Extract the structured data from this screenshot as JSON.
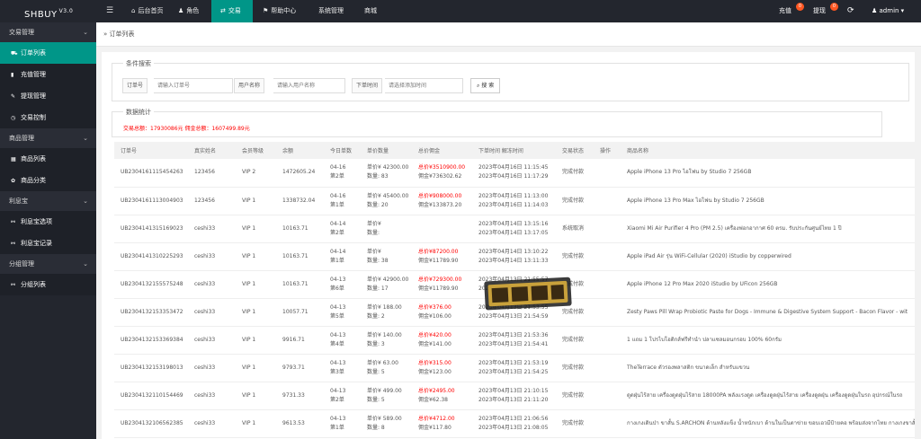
{
  "header": {
    "logo": "SHBUY",
    "version": "V3.0",
    "nav": [
      {
        "label": "后台首页",
        "icon": "home-icon",
        "glyph": "⌂"
      },
      {
        "label": "角色",
        "icon": "user-icon",
        "glyph": "♟"
      },
      {
        "label": "交易",
        "icon": "transaction-icon",
        "glyph": "⇄"
      },
      {
        "label": "帮助中心",
        "icon": "flag-icon",
        "glyph": "⚑"
      },
      {
        "label": "系统管理",
        "icon": "",
        "glyph": ""
      },
      {
        "label": "商城",
        "icon": "",
        "glyph": ""
      }
    ],
    "recharge": "充值",
    "recharge_badge": "0",
    "withdraw": "提现",
    "withdraw_badge": "0",
    "refresh_glyph": "⟳",
    "user": "admin"
  },
  "sidebar": {
    "groups": [
      {
        "label": "交易管理",
        "items": [
          {
            "label": "订单列表",
            "glyph": "⛟",
            "icon": "cart-icon"
          },
          {
            "label": "充值管理",
            "glyph": "▮",
            "icon": "wallet-icon"
          },
          {
            "label": "提现管理",
            "glyph": "✎",
            "icon": "edit-icon"
          },
          {
            "label": "交易控制",
            "glyph": "◷",
            "icon": "clock-icon"
          }
        ]
      },
      {
        "label": "商品管理",
        "items": [
          {
            "label": "商品列表",
            "glyph": "▦",
            "icon": "list-icon"
          },
          {
            "label": "商品分类",
            "glyph": "✿",
            "icon": "category-icon"
          }
        ]
      },
      {
        "label": "利息宝",
        "items": [
          {
            "label": "利息宝选项",
            "glyph": "⚯",
            "icon": "link-icon"
          },
          {
            "label": "利息宝记录",
            "glyph": "⚯",
            "icon": "link-icon"
          }
        ]
      },
      {
        "label": "分组管理",
        "items": [
          {
            "label": "分组列表",
            "glyph": "⚯",
            "icon": "link-icon"
          }
        ]
      }
    ]
  },
  "breadcrumb": "订单列表",
  "search": {
    "legend": "条件搜索",
    "order_label": "订单号",
    "order_placeholder": "请输入订单号",
    "user_label": "用户名称",
    "user_placeholder": "请输入用户名称",
    "time_label": "下单时间",
    "time_placeholder": "请选择添加时间",
    "button": "搜 索"
  },
  "stats": {
    "legend": "数据统计",
    "text": "交易总额：17930086元   佣金总额：1607499.89元"
  },
  "table": {
    "columns": [
      "订单号",
      "真实姓名",
      "会员等级",
      "余额",
      "今日单数",
      "单价数量",
      "总价佣金",
      "下单时间 解冻时间",
      "交易状态",
      "操作",
      "商品名称"
    ],
    "rows": [
      {
        "order": "UB2304161115454263",
        "name": "123456",
        "level": "VIP 2",
        "balance": "1472605.24",
        "today1": "04-16",
        "today2": "第2单",
        "price1": "单价¥ 42300.00",
        "price2": "数量: 83",
        "total1": "总价¥3510900.00",
        "total2": "佣金¥736302.62",
        "time1": "2023年04月16日 11:15:45",
        "time2": "2023年04月16日 11:17:29",
        "status": "完成付款",
        "product": "Apple iPhone 13 Pro ไอโฟน by Studio 7 256GB"
      },
      {
        "order": "UB2304161113004903",
        "name": "123456",
        "level": "VIP 1",
        "balance": "1338732.04",
        "today1": "04-16",
        "today2": "第1单",
        "price1": "单价¥ 45400.00",
        "price2": "数量: 20",
        "total1": "总价¥908000.00",
        "total2": "佣金¥133873.20",
        "time1": "2023年04月16日 11:13:00",
        "time2": "2023年04月16日 11:14:03",
        "status": "完成付款",
        "product": "Apple iPhone 13 Pro Max ไอโฟน by Studio 7 256GB"
      },
      {
        "order": "UB2304141315169023",
        "name": "ceshi33",
        "level": "VIP 1",
        "balance": "10163.71",
        "today1": "04-14",
        "today2": "第2单",
        "price1": "单价¥",
        "price2": "数量:",
        "total1": "",
        "total2": "",
        "time1": "2023年04月14日 13:15:16",
        "time2": "2023年04月14日 13:17:05",
        "status": "系统取消",
        "product": "Xiaomi Mi Air Purifier 4 Pro (PM 2.5) เครื่องฟอกอากาศ 60 ตรม. รับประกันศูนย์ไทย 1 ปี"
      },
      {
        "order": "UB2304141310225293",
        "name": "ceshi33",
        "level": "VIP 1",
        "balance": "10163.71",
        "today1": "04-14",
        "today2": "第1单",
        "price1": "单价¥",
        "price2": "数量: 38",
        "total1": "总价¥87200.00",
        "total2": "佣金¥11789.90",
        "time1": "2023年04月14日 13:10:22",
        "time2": "2023年04月14日 13:11:33",
        "status": "完成付款",
        "product": "Apple iPad Air รุ่น WiFi-Cellular (2020) iStudio by copperwired"
      },
      {
        "order": "UB2304132155575248",
        "name": "ceshi33",
        "level": "VIP 1",
        "balance": "10163.71",
        "today1": "04-13",
        "today2": "第6单",
        "price1": "单价¥ 42900.00",
        "price2": "数量: 17",
        "total1": "总价¥729300.00",
        "total2": "佣金¥11789.90",
        "time1": "2023年04月13日 21:55:57",
        "time2": "2023年04月13日 22:17:16",
        "status": "完成付款",
        "product": "Apple iPhone 12 Pro Max 2020 iStudio by UFicon 256GB"
      },
      {
        "order": "UB2304132153353472",
        "name": "ceshi33",
        "level": "VIP 1",
        "balance": "10057.71",
        "today1": "04-13",
        "today2": "第5单",
        "price1": "单价¥ 188.00",
        "price2": "数量: 2",
        "total1": "总价¥376.00",
        "total2": "佣金¥106.00",
        "time1": "2023年04月13日 21:53:55",
        "time2": "2023年04月13日 21:54:59",
        "status": "完成付款",
        "product": "Zesty Paws Pill Wrap Probiotic Paste for Dogs - Immune & Digestive System Support - Bacon Flavor - wit"
      },
      {
        "order": "UB2304132153369384",
        "name": "ceshi33",
        "level": "VIP 1",
        "balance": "9916.71",
        "today1": "04-13",
        "today2": "第4单",
        "price1": "单价¥ 140.00",
        "price2": "数量: 3",
        "total1": "总价¥420.00",
        "total2": "佣金¥141.00",
        "time1": "2023年04月13日 21:53:36",
        "time2": "2023年04月13日 21:54:41",
        "status": "完成付款",
        "product": "1 แถม 1 โปรไบโอติกส์ฟรีทำนำ ปลาแซลมอนกรอบ 100% 60กรัม"
      },
      {
        "order": "UB2304132153198013",
        "name": "ceshi33",
        "level": "VIP 1",
        "balance": "9793.71",
        "today1": "04-13",
        "today2": "第3单",
        "price1": "单价¥ 63.00",
        "price2": "数量: 5",
        "total1": "总价¥315.00",
        "total2": "佣金¥123.00",
        "time1": "2023年04月13日 21:53:19",
        "time2": "2023年04月13日 21:54:25",
        "status": "完成付款",
        "product": "TheTerrace ตัวรองพลาสติก ขนาดเล็ก สำหรับแขวน"
      },
      {
        "order": "UB2304132110154469",
        "name": "ceshi33",
        "level": "VIP 1",
        "balance": "9731.33",
        "today1": "04-13",
        "today2": "第2单",
        "price1": "单价¥ 499.00",
        "price2": "数量: 5",
        "total1": "总价¥2495.00",
        "total2": "佣金¥62.38",
        "time1": "2023年04月13日 21:10:15",
        "time2": "2023年04月13日 21:11:20",
        "status": "完成付款",
        "product": "ดูดฝุ่นไร้สาย เครื่องดูดฝุ่นไร้สาย 18000PA พลังแรงดูด เครื่องดูดฝุ่นไร้สาย เครื่องดูดฝุ่น เครื่องดูดฝุ่นในรถ อุปกรณ์ในรถ"
      },
      {
        "order": "UB2304132106562385",
        "name": "ceshi33",
        "level": "VIP 1",
        "balance": "9613.53",
        "today1": "04-13",
        "today2": "第1单",
        "price1": "单价¥ 589.00",
        "price2": "数量: 8",
        "total1": "总价¥4712.00",
        "total2": "佣金¥117.80",
        "time1": "2023年04月13日 21:06:56",
        "time2": "2023年04月13日 21:08:05",
        "status": "完成付款",
        "product": "กางเกงเดินป่า ขาสั้น S.ARCHON ด้านหลังแข็ง น้ำหนักเบา ด้านในเป็นตาข่าย ขอบเอวมีป้ายคอ พร้อมส่งจากไทย กางเกงขาสั้น"
      }
    ]
  },
  "colors": {
    "accent": "#009688",
    "sidebar": "#23262e",
    "danger": "#ff0000",
    "badge": "#ff5722"
  }
}
